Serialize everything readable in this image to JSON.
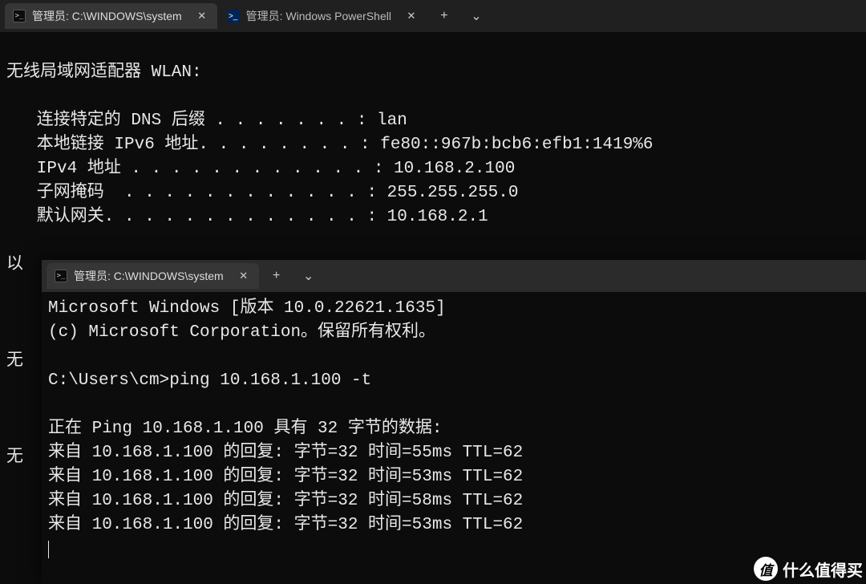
{
  "win1": {
    "tabs": [
      {
        "label": "管理员: C:\\WINDOWS\\system",
        "icon": "cmd",
        "active": true
      },
      {
        "label": "管理员: Windows PowerShell",
        "icon": "ps",
        "active": false
      }
    ],
    "lines": [
      "",
      "无线局域网适配器 WLAN:",
      "",
      "   连接特定的 DNS 后缀 . . . . . . . : lan",
      "   本地链接 IPv6 地址. . . . . . . . : fe80::967b:bcb6:efb1:1419%6",
      "   IPv4 地址 . . . . . . . . . . . . : 10.168.2.100",
      "   子网掩码  . . . . . . . . . . . . : 255.255.255.0",
      "   默认网关. . . . . . . . . . . . . : 10.168.2.1",
      "",
      "以",
      "",
      "",
      "",
      "无",
      "",
      "",
      "",
      "无"
    ]
  },
  "win2": {
    "tabs": [
      {
        "label": "管理员: C:\\WINDOWS\\system",
        "icon": "cmd",
        "active": true
      }
    ],
    "lines": [
      "Microsoft Windows [版本 10.0.22621.1635]",
      "(c) Microsoft Corporation。保留所有权利。",
      "",
      "C:\\Users\\cm>ping 10.168.1.100 -t",
      "",
      "正在 Ping 10.168.1.100 具有 32 字节的数据:",
      "来自 10.168.1.100 的回复: 字节=32 时间=55ms TTL=62",
      "来自 10.168.1.100 的回复: 字节=32 时间=53ms TTL=62",
      "来自 10.168.1.100 的回复: 字节=32 时间=58ms TTL=62",
      "来自 10.168.1.100 的回复: 字节=32 时间=53ms TTL=62"
    ]
  },
  "buttons": {
    "new_tab": "+",
    "dropdown": "⌄",
    "close": "✕"
  },
  "watermark": {
    "badge": "值",
    "text": "什么值得买"
  }
}
